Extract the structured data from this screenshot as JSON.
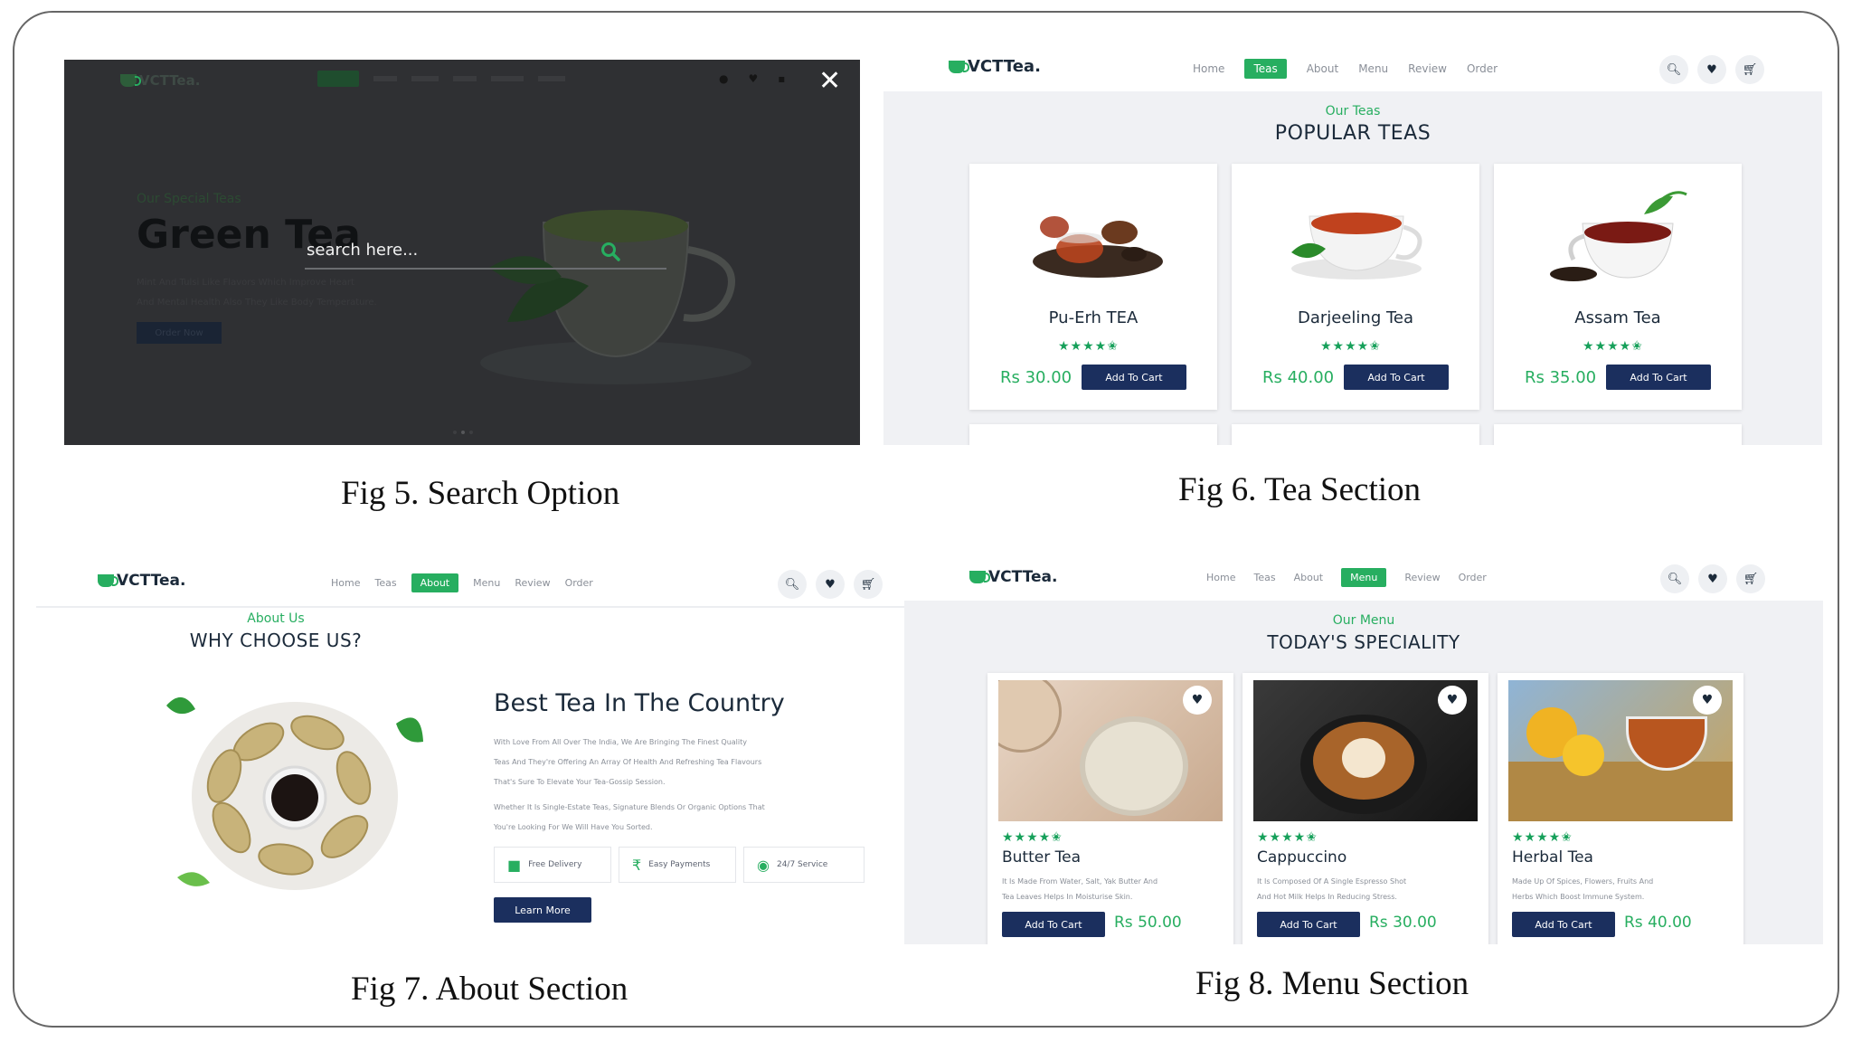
{
  "fig5": {
    "caption": "Fig 5. Search Option",
    "logo": "VCTTea.",
    "hero_subtitle": "Our Special Teas",
    "hero_title": "Green Tea",
    "hero_text_1": "Mint And Tulsi Like Flavors Which Improve Heart",
    "hero_text_2": "And Mental Health Also They Like Body Temperature.",
    "hero_button": "Order Now",
    "search_placeholder": "search here...",
    "close_label": "✕"
  },
  "fig6": {
    "caption": "Fig 6. Tea Section",
    "logo": "VCTTea.",
    "nav": [
      "Home",
      "Teas",
      "About",
      "Menu",
      "Review",
      "Order"
    ],
    "active": "Teas",
    "subtitle": "Our Teas",
    "title": "POPULAR TEAS",
    "cards": [
      {
        "name": "Pu-Erh TEA",
        "price": "Rs 30.00",
        "button": "Add To Cart",
        "rating": 4.5
      },
      {
        "name": "Darjeeling Tea",
        "price": "Rs 40.00",
        "button": "Add To Cart",
        "rating": 4.5
      },
      {
        "name": "Assam Tea",
        "price": "Rs 35.00",
        "button": "Add To Cart",
        "rating": 4.5
      }
    ]
  },
  "fig7": {
    "caption": "Fig 7. About Section",
    "logo": "VCTTea.",
    "nav": [
      "Home",
      "Teas",
      "About",
      "Menu",
      "Review",
      "Order"
    ],
    "active": "About",
    "subtitle": "About Us",
    "title": "WHY CHOOSE US?",
    "heading": "Best Tea In The Country",
    "para1": [
      "With Love From All Over The India, We Are Bringing The Finest Quality",
      "Teas And They're Offering An Array Of Health And Refreshing Tea Flavours",
      "That's Sure To Elevate Your Tea-Gossip Session."
    ],
    "para2": [
      "Whether It Is Single-Estate Teas, Signature Blends Or Organic Options That",
      "You're Looking For We Will Have You Sorted."
    ],
    "features": [
      "Free Delivery",
      "Easy Payments",
      "24/7 Service"
    ],
    "button": "Learn More"
  },
  "fig8": {
    "caption": "Fig 8. Menu Section",
    "logo": "VCTTea.",
    "nav": [
      "Home",
      "Teas",
      "About",
      "Menu",
      "Review",
      "Order"
    ],
    "active": "Menu",
    "subtitle": "Our Menu",
    "title": "TODAY'S SPECIALITY",
    "items": [
      {
        "name": "Butter Tea",
        "desc1": "It Is Made From Water, Salt, Yak Butter And",
        "desc2": "Tea Leaves Helps In Moisturise Skin.",
        "button": "Add To Cart",
        "price": "Rs 50.00",
        "rating": 4.5
      },
      {
        "name": "Cappuccino",
        "desc1": "It Is Composed Of A Single Espresso Shot",
        "desc2": "And Hot Milk Helps In Reducing Stress.",
        "button": "Add To Cart",
        "price": "Rs 30.00",
        "rating": 4.5
      },
      {
        "name": "Herbal Tea",
        "desc1": "Made Up Of Spices, Flowers, Fruits And",
        "desc2": "Herbs Which Boost Immune System.",
        "button": "Add To Cart",
        "price": "Rs 40.00",
        "rating": 4.5
      }
    ]
  },
  "icons": {
    "search": "search-icon",
    "heart": "heart-icon",
    "cart": "cart-icon"
  },
  "colors": {
    "accent": "#27ae60",
    "navy": "#1b2f5e",
    "text": "#1b2a3a"
  }
}
